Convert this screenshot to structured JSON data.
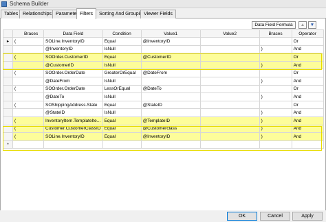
{
  "window": {
    "title": "Schema Builder"
  },
  "tabs": [
    "Tables",
    "Relationships",
    "Parameters",
    "Filters",
    "Sorting And Grouping",
    "Viewer Fields"
  ],
  "toolbar": {
    "formula_label": "Data Field Formula",
    "up_glyph": "▲",
    "down_glyph": "▼"
  },
  "columns": [
    "Braces",
    "Data Field",
    "Condition",
    "Value1",
    "Value2",
    "Braces",
    "Operator"
  ],
  "rows": [
    {
      "sel": "▸",
      "braces_open": "(",
      "data_field": "SOLine.InventoryID",
      "condition": "Equal",
      "value1": "@InventoryID",
      "value2": "",
      "braces_close": "",
      "operator": "Or",
      "highlight": false
    },
    {
      "sel": "",
      "braces_open": "",
      "data_field": "@InventoryID",
      "condition": "IsNull",
      "value1": "",
      "value2": "",
      "braces_close": ")",
      "operator": "And",
      "highlight": false
    },
    {
      "sel": "",
      "braces_open": "(",
      "data_field": "SOOrder.CustomerID",
      "condition": "Equal",
      "value1": "@CustomerID",
      "value2": "",
      "braces_close": "",
      "operator": "Or",
      "highlight": true
    },
    {
      "sel": "",
      "braces_open": "",
      "data_field": "@CustomerID",
      "condition": "IsNull",
      "value1": "",
      "value2": "",
      "braces_close": ")",
      "operator": "And",
      "highlight": true
    },
    {
      "sel": "",
      "braces_open": "(",
      "data_field": "SOOrder.OrderDate",
      "condition": "GreaterOrEqual",
      "value1": "@DateFrom",
      "value2": "",
      "braces_close": "",
      "operator": "Or",
      "highlight": false
    },
    {
      "sel": "",
      "braces_open": "",
      "data_field": "@DateFrom",
      "condition": "IsNull",
      "value1": "",
      "value2": "",
      "braces_close": ")",
      "operator": "And",
      "highlight": false
    },
    {
      "sel": "",
      "braces_open": "(",
      "data_field": "SOOrder.OrderDate",
      "condition": "LessOrEqual",
      "value1": "@DateTo",
      "value2": "",
      "braces_close": "",
      "operator": "Or",
      "highlight": false
    },
    {
      "sel": "",
      "braces_open": "",
      "data_field": "@DateTo",
      "condition": "IsNull",
      "value1": "",
      "value2": "",
      "braces_close": ")",
      "operator": "And",
      "highlight": false
    },
    {
      "sel": "",
      "braces_open": "(",
      "data_field": "SOShippingAddress.State",
      "condition": "Equal",
      "value1": "@StateID",
      "value2": "",
      "braces_close": "",
      "operator": "Or",
      "highlight": false
    },
    {
      "sel": "",
      "braces_open": "",
      "data_field": "@StateID",
      "condition": "IsNull",
      "value1": "",
      "value2": "",
      "braces_close": ")",
      "operator": "And",
      "highlight": false
    },
    {
      "sel": "",
      "braces_open": "(",
      "data_field": "InventoryItem.TemplateIte...",
      "condition": "Equal",
      "value1": "@TemplateID",
      "value2": "",
      "braces_close": ")",
      "operator": "And",
      "highlight": true
    },
    {
      "sel": "",
      "braces_open": "(",
      "data_field": "Customer.CustomerClassID",
      "condition": "Equal",
      "value1": "@Customerclass",
      "value2": "",
      "braces_close": ")",
      "operator": "And",
      "highlight": true
    },
    {
      "sel": "",
      "braces_open": "(",
      "data_field": "SOLine.InventoryID",
      "condition": "Equal",
      "value1": "@InventoryID",
      "value2": "",
      "braces_close": ")",
      "operator": "And",
      "highlight": true
    },
    {
      "sel": "*",
      "braces_open": "",
      "data_field": "",
      "condition": "",
      "value1": "",
      "value2": "",
      "braces_close": "",
      "operator": "",
      "highlight": false
    }
  ],
  "buttons": {
    "ok": "OK",
    "cancel": "Cancel",
    "apply": "Apply"
  },
  "colors": {
    "highlight": "#fdfd9a",
    "highlight_border": "#e8dc00"
  }
}
